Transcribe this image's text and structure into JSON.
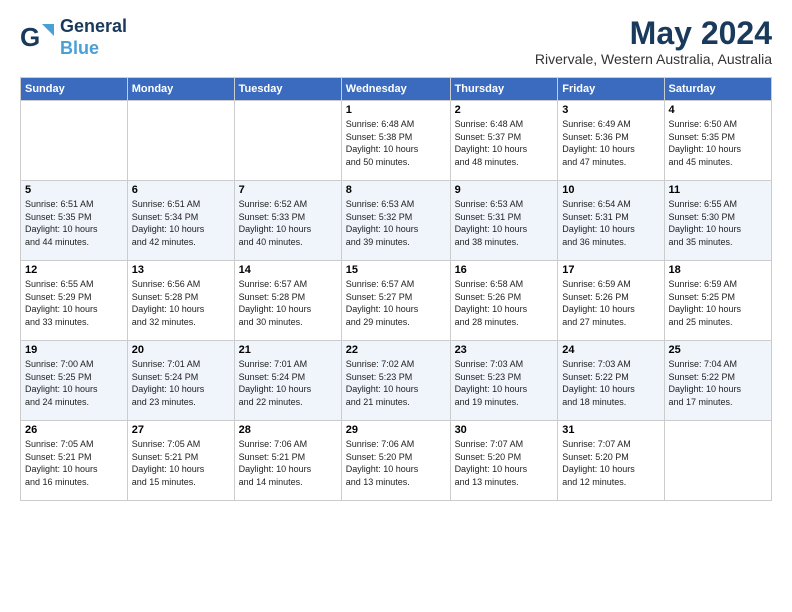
{
  "header": {
    "logo_line1": "General",
    "logo_line2": "Blue",
    "month_title": "May 2024",
    "location": "Rivervale, Western Australia, Australia"
  },
  "weekdays": [
    "Sunday",
    "Monday",
    "Tuesday",
    "Wednesday",
    "Thursday",
    "Friday",
    "Saturday"
  ],
  "weeks": [
    [
      {
        "day": "",
        "info": ""
      },
      {
        "day": "",
        "info": ""
      },
      {
        "day": "",
        "info": ""
      },
      {
        "day": "1",
        "info": "Sunrise: 6:48 AM\nSunset: 5:38 PM\nDaylight: 10 hours\nand 50 minutes."
      },
      {
        "day": "2",
        "info": "Sunrise: 6:48 AM\nSunset: 5:37 PM\nDaylight: 10 hours\nand 48 minutes."
      },
      {
        "day": "3",
        "info": "Sunrise: 6:49 AM\nSunset: 5:36 PM\nDaylight: 10 hours\nand 47 minutes."
      },
      {
        "day": "4",
        "info": "Sunrise: 6:50 AM\nSunset: 5:35 PM\nDaylight: 10 hours\nand 45 minutes."
      }
    ],
    [
      {
        "day": "5",
        "info": "Sunrise: 6:51 AM\nSunset: 5:35 PM\nDaylight: 10 hours\nand 44 minutes."
      },
      {
        "day": "6",
        "info": "Sunrise: 6:51 AM\nSunset: 5:34 PM\nDaylight: 10 hours\nand 42 minutes."
      },
      {
        "day": "7",
        "info": "Sunrise: 6:52 AM\nSunset: 5:33 PM\nDaylight: 10 hours\nand 40 minutes."
      },
      {
        "day": "8",
        "info": "Sunrise: 6:53 AM\nSunset: 5:32 PM\nDaylight: 10 hours\nand 39 minutes."
      },
      {
        "day": "9",
        "info": "Sunrise: 6:53 AM\nSunset: 5:31 PM\nDaylight: 10 hours\nand 38 minutes."
      },
      {
        "day": "10",
        "info": "Sunrise: 6:54 AM\nSunset: 5:31 PM\nDaylight: 10 hours\nand 36 minutes."
      },
      {
        "day": "11",
        "info": "Sunrise: 6:55 AM\nSunset: 5:30 PM\nDaylight: 10 hours\nand 35 minutes."
      }
    ],
    [
      {
        "day": "12",
        "info": "Sunrise: 6:55 AM\nSunset: 5:29 PM\nDaylight: 10 hours\nand 33 minutes."
      },
      {
        "day": "13",
        "info": "Sunrise: 6:56 AM\nSunset: 5:28 PM\nDaylight: 10 hours\nand 32 minutes."
      },
      {
        "day": "14",
        "info": "Sunrise: 6:57 AM\nSunset: 5:28 PM\nDaylight: 10 hours\nand 30 minutes."
      },
      {
        "day": "15",
        "info": "Sunrise: 6:57 AM\nSunset: 5:27 PM\nDaylight: 10 hours\nand 29 minutes."
      },
      {
        "day": "16",
        "info": "Sunrise: 6:58 AM\nSunset: 5:26 PM\nDaylight: 10 hours\nand 28 minutes."
      },
      {
        "day": "17",
        "info": "Sunrise: 6:59 AM\nSunset: 5:26 PM\nDaylight: 10 hours\nand 27 minutes."
      },
      {
        "day": "18",
        "info": "Sunrise: 6:59 AM\nSunset: 5:25 PM\nDaylight: 10 hours\nand 25 minutes."
      }
    ],
    [
      {
        "day": "19",
        "info": "Sunrise: 7:00 AM\nSunset: 5:25 PM\nDaylight: 10 hours\nand 24 minutes."
      },
      {
        "day": "20",
        "info": "Sunrise: 7:01 AM\nSunset: 5:24 PM\nDaylight: 10 hours\nand 23 minutes."
      },
      {
        "day": "21",
        "info": "Sunrise: 7:01 AM\nSunset: 5:24 PM\nDaylight: 10 hours\nand 22 minutes."
      },
      {
        "day": "22",
        "info": "Sunrise: 7:02 AM\nSunset: 5:23 PM\nDaylight: 10 hours\nand 21 minutes."
      },
      {
        "day": "23",
        "info": "Sunrise: 7:03 AM\nSunset: 5:23 PM\nDaylight: 10 hours\nand 19 minutes."
      },
      {
        "day": "24",
        "info": "Sunrise: 7:03 AM\nSunset: 5:22 PM\nDaylight: 10 hours\nand 18 minutes."
      },
      {
        "day": "25",
        "info": "Sunrise: 7:04 AM\nSunset: 5:22 PM\nDaylight: 10 hours\nand 17 minutes."
      }
    ],
    [
      {
        "day": "26",
        "info": "Sunrise: 7:05 AM\nSunset: 5:21 PM\nDaylight: 10 hours\nand 16 minutes."
      },
      {
        "day": "27",
        "info": "Sunrise: 7:05 AM\nSunset: 5:21 PM\nDaylight: 10 hours\nand 15 minutes."
      },
      {
        "day": "28",
        "info": "Sunrise: 7:06 AM\nSunset: 5:21 PM\nDaylight: 10 hours\nand 14 minutes."
      },
      {
        "day": "29",
        "info": "Sunrise: 7:06 AM\nSunset: 5:20 PM\nDaylight: 10 hours\nand 13 minutes."
      },
      {
        "day": "30",
        "info": "Sunrise: 7:07 AM\nSunset: 5:20 PM\nDaylight: 10 hours\nand 13 minutes."
      },
      {
        "day": "31",
        "info": "Sunrise: 7:07 AM\nSunset: 5:20 PM\nDaylight: 10 hours\nand 12 minutes."
      },
      {
        "day": "",
        "info": ""
      }
    ]
  ]
}
